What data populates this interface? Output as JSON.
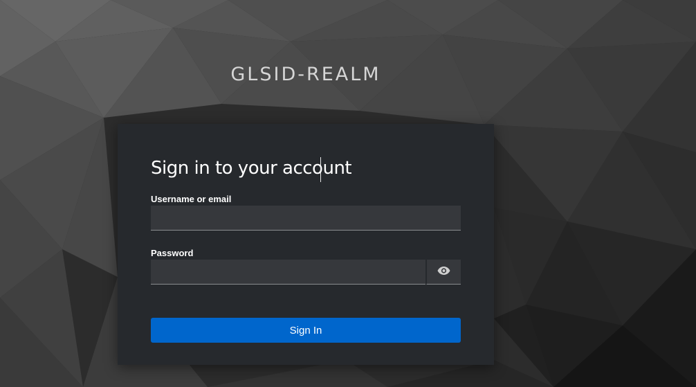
{
  "realm": {
    "title": "GLSID-REALM"
  },
  "login": {
    "heading": "Sign in to your account",
    "username_label": "Username or email",
    "username_value": "",
    "password_label": "Password",
    "password_value": "",
    "show_password_icon": "eye-icon",
    "submit_label": "Sign In"
  },
  "colors": {
    "card_background": "#26292d",
    "input_background": "#36383c",
    "primary_button": "#0066cc",
    "text_primary": "#ffffff",
    "realm_title": "#d6d6d6"
  }
}
